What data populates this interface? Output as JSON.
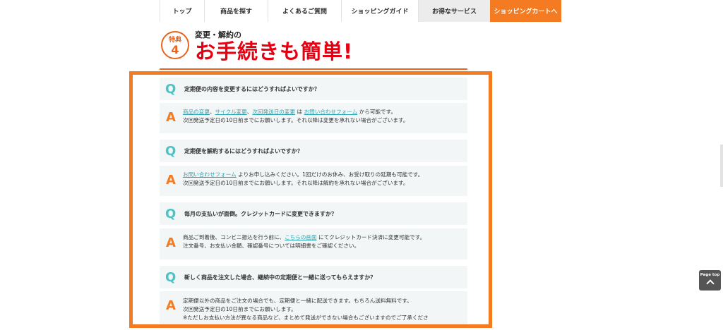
{
  "nav": {
    "items": [
      {
        "label": "トップ",
        "width": 63
      },
      {
        "label": "商品を探す",
        "width": 90
      },
      {
        "label": "よくあるご質問",
        "width": 104
      },
      {
        "label": "ショッピングガイド",
        "width": 109
      },
      {
        "label": "お得なサービス",
        "width": 102
      }
    ],
    "cart_label": "ショッピングカートへ"
  },
  "heading": {
    "badge_top": "特典",
    "badge_num": "4",
    "subtitle": "変更・解約の",
    "title": "お手続きも簡単!"
  },
  "qa": [
    {
      "q": "定期便の内容を変更するにはどうすればよいですか？",
      "a": {
        "link1": "商品の変更",
        "sep1": "、",
        "link2": "サイクル変更",
        "sep2": "、",
        "link3": "次回発送日の変更",
        "mid": " は ",
        "link4": "お問い合わせフォーム",
        "end": " から可能です。",
        "line2": "次回発送予定日の10日前までにお願いします。それ以降は変更を承れない場合がございます。"
      }
    },
    {
      "q": "定期便を解約するにはどうすればよいですか？",
      "a": {
        "link1": "お問い合わせフォーム",
        "end": " よりお申し込みください。1回だけのお休み、お受け取りの延期も可能です。",
        "line2": "次回発送予定日の10日前までにお願いします。それ以降は解約を承れない場合がございます。"
      }
    },
    {
      "q": "毎月の支払いが面倒。クレジットカードに変更できますか？",
      "a": {
        "start": "商品ご到着後、コンビニ振込を行う前に、",
        "link1": "こちらの画面",
        "end": " にてクレジットカード決済に変更可能です。",
        "line2": "注文番号、お支払い金額、確認番号については明細書をご確認ください。"
      }
    },
    {
      "q": "新しく商品を注文した場合、継続中の定期便と一緒に送ってもらえますか？",
      "a": {
        "line1": "定期便以外の商品をご注文の場合でも、定期便と一緒に配送できます。もちろん送料無料です。",
        "line2": "次回発送予定日の10日前までにお願いします。",
        "line3": "※ただしお支払い方法が異なる商品など、まとめて発送ができない場合もございますのでご了承くださ"
      }
    }
  ],
  "icons": {
    "q": "Q",
    "a": "A"
  },
  "pagetop_label": "Page top",
  "colors": {
    "accent": "#f47b21",
    "title_red": "#e60012",
    "q_teal": "#4ec3c3",
    "link": "#2aa7b5"
  }
}
